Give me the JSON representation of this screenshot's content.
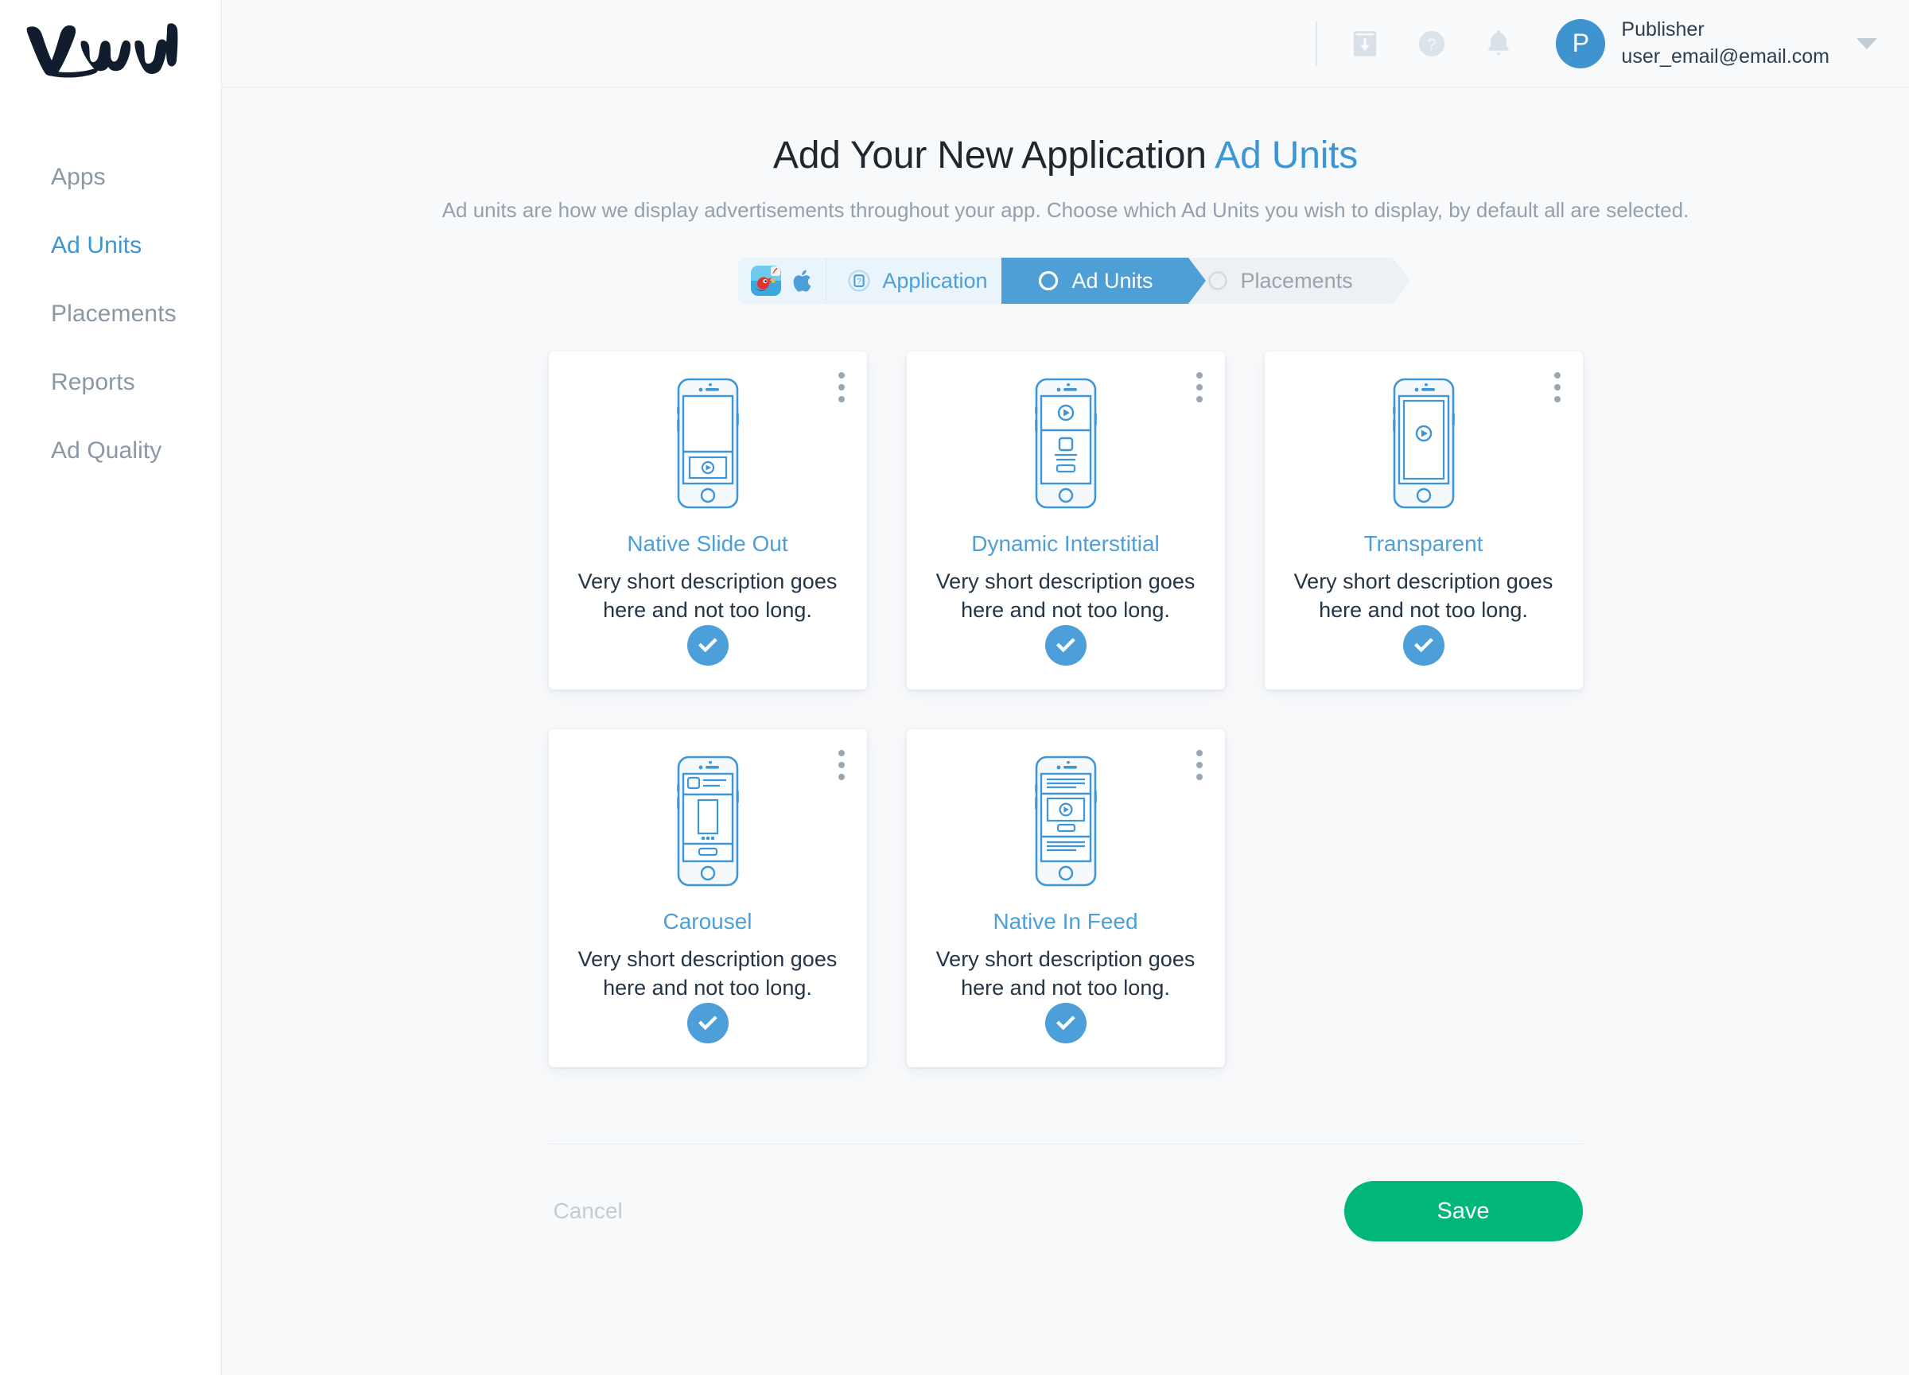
{
  "brand": {
    "logo_text": "Vungle",
    "accent_blue": "#4c9fd8",
    "accent_green": "#00b67a"
  },
  "sidebar": {
    "items": [
      {
        "label": "Apps",
        "active": false
      },
      {
        "label": "Ad Units",
        "active": true
      },
      {
        "label": "Placements",
        "active": false
      },
      {
        "label": "Reports",
        "active": false
      },
      {
        "label": "Ad Quality",
        "active": false
      }
    ]
  },
  "topbar": {
    "icons": [
      "download-icon",
      "help-icon",
      "notifications-icon"
    ],
    "avatar_initial": "P",
    "user_name": "Publisher",
    "user_email": "user_email@email.com"
  },
  "page": {
    "title_main": "Add Your New Application ",
    "title_accent": "Ad Units",
    "subtitle": "Ad units are how we display advertisements throughout your app. Choose which Ad Units you wish to display, by default all are selected."
  },
  "stepper": {
    "app_icon": "angry-birds-app-icon",
    "platform_icon": "apple-icon",
    "steps": [
      {
        "label": "Application",
        "state": "done"
      },
      {
        "label": "Ad Units",
        "state": "current"
      },
      {
        "label": "Placements",
        "state": "todo"
      }
    ]
  },
  "ad_units": [
    {
      "title": "Native Slide Out",
      "description": "Very short description goes here and not too long.",
      "selected": true,
      "icon": "phone-slide-out-icon"
    },
    {
      "title": "Dynamic Interstitial",
      "description": "Very short description goes here and not too long.",
      "selected": true,
      "icon": "phone-interstitial-icon"
    },
    {
      "title": "Transparent",
      "description": "Very short description goes here and not too long.",
      "selected": true,
      "icon": "phone-transparent-icon"
    },
    {
      "title": "Carousel",
      "description": "Very short description goes here and not too long.",
      "selected": true,
      "icon": "phone-carousel-icon"
    },
    {
      "title": "Native In Feed",
      "description": "Very short description goes here and not too long.",
      "selected": true,
      "icon": "phone-in-feed-icon"
    }
  ],
  "footer": {
    "cancel_label": "Cancel",
    "save_label": "Save"
  }
}
